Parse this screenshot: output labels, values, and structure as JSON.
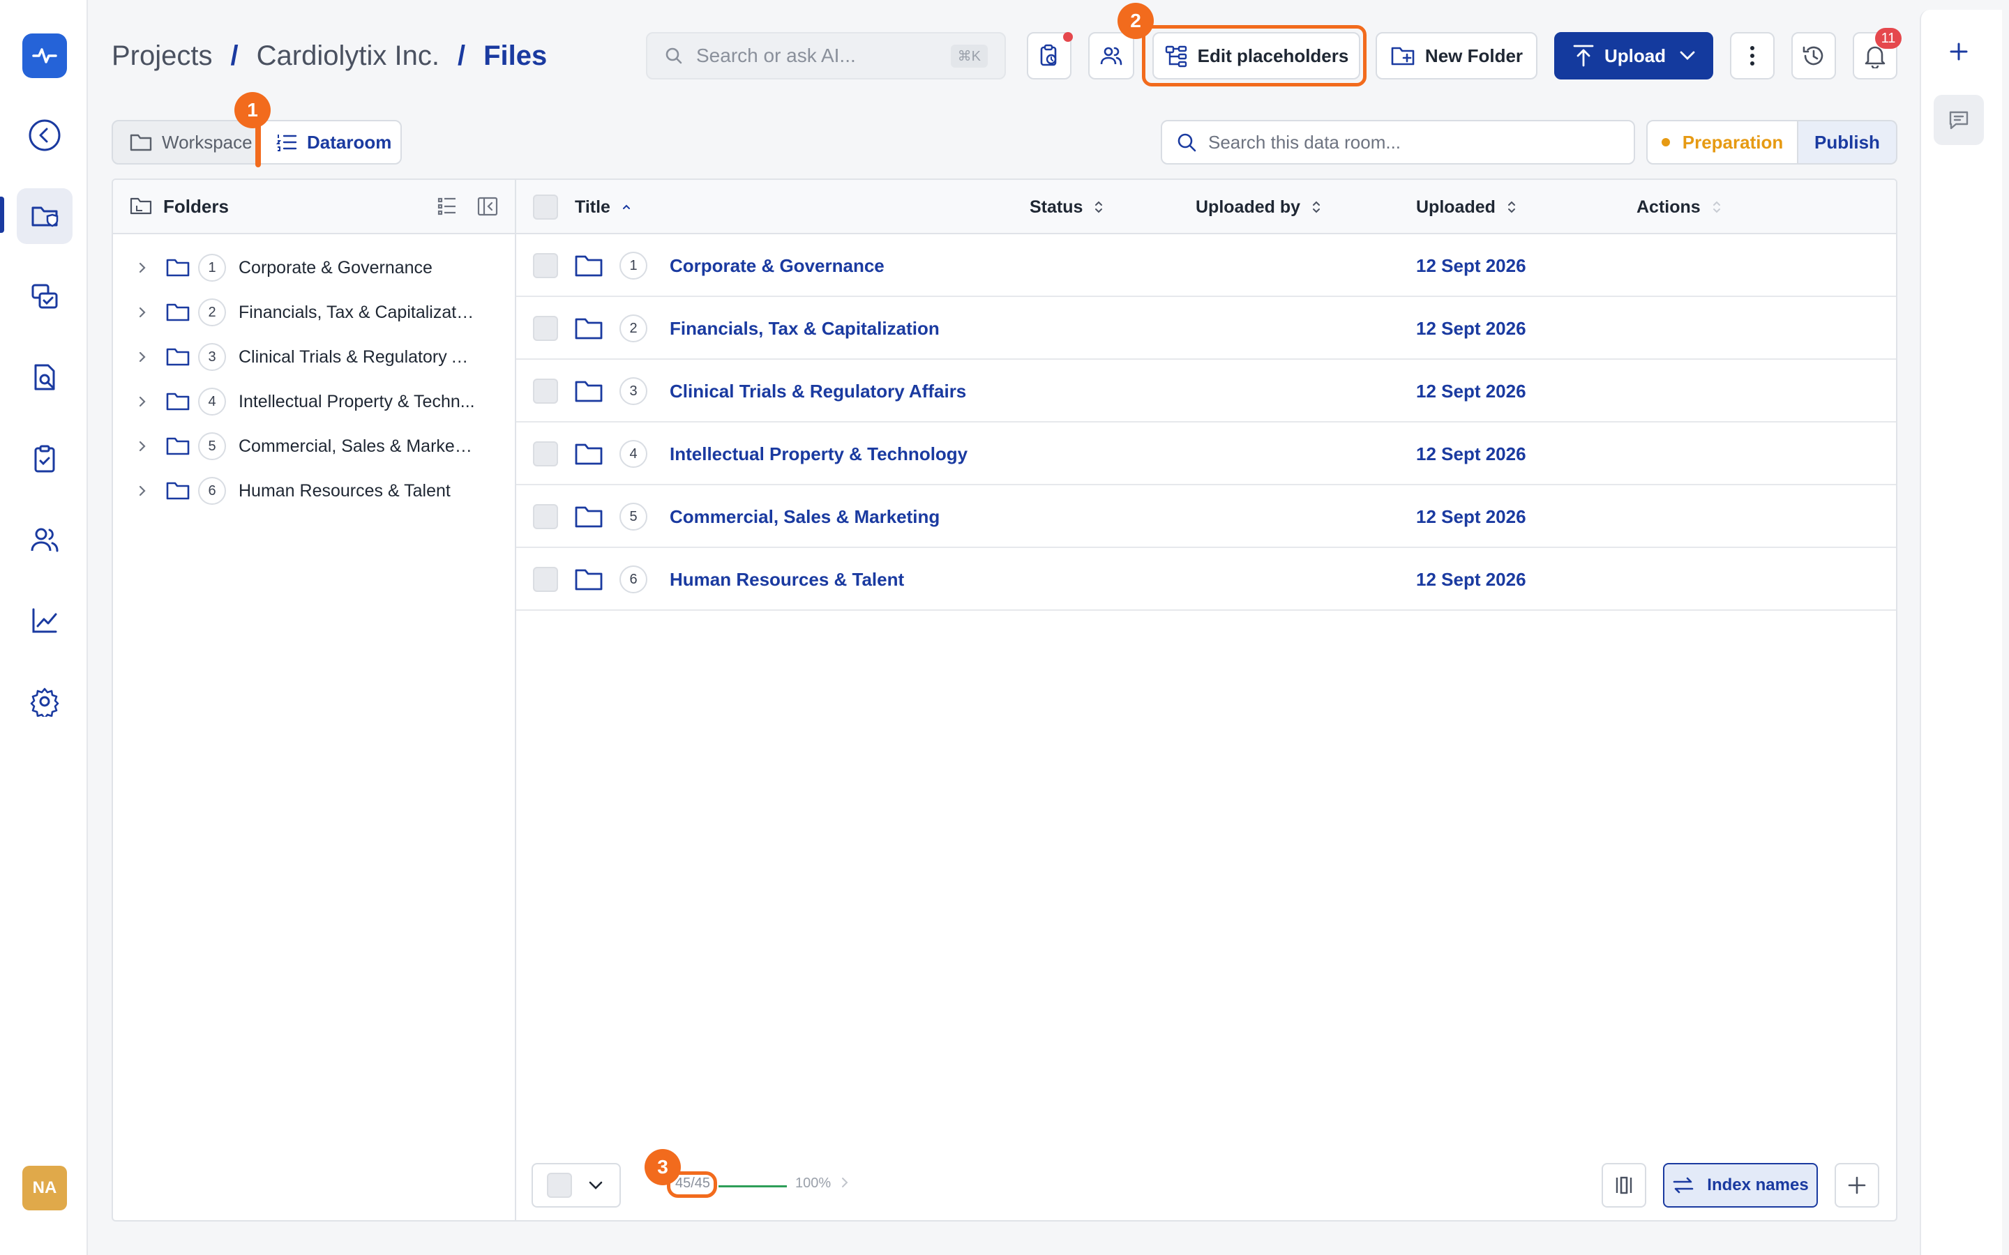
{
  "colors": {
    "brand": "#143a9e",
    "logo": "#2563d8",
    "highlight": "#f26b1d",
    "preparation": "#e69a13",
    "notification": "#e5484d",
    "progress": "#2e9e58"
  },
  "nav": {
    "logo_icon": "heartbeat-icon",
    "items": [
      "back-icon",
      "dataroom-files-icon",
      "qa-checklist-icon",
      "document-search-icon",
      "clipboard-icon",
      "users-icon",
      "analytics-icon",
      "settings-icon"
    ],
    "active": "dataroom-files-icon",
    "avatar": "NA"
  },
  "breadcrumb": {
    "items": [
      "Projects",
      "Cardiolytix Inc.",
      "Files"
    ],
    "separator": "/"
  },
  "search": {
    "placeholder": "Search or ask AI...",
    "shortcut": "⌘K"
  },
  "toolbar": {
    "edit_placeholders": "Edit placeholders",
    "new_folder": "New Folder",
    "upload": "Upload",
    "notifications_count": "11"
  },
  "steps": {
    "one": "1",
    "two": "2",
    "three": "3"
  },
  "view_tabs": {
    "workspace": "Workspace",
    "dataroom": "Dataroom",
    "active": "Dataroom"
  },
  "dataroom_search": {
    "placeholder": "Search this data room..."
  },
  "mode": {
    "preparation": "Preparation",
    "publish": "Publish",
    "active": "Publish"
  },
  "folders_panel": {
    "title": "Folders",
    "items": [
      {
        "num": "1",
        "label": "Corporate & Governance"
      },
      {
        "num": "2",
        "label": "Financials, Tax & Capitalization"
      },
      {
        "num": "3",
        "label": "Clinical Trials & Regulatory A..."
      },
      {
        "num": "4",
        "label": "Intellectual Property & Techn..."
      },
      {
        "num": "5",
        "label": "Commercial, Sales & Marketi..."
      },
      {
        "num": "6",
        "label": "Human Resources & Talent"
      }
    ]
  },
  "table": {
    "columns": {
      "title": "Title",
      "status": "Status",
      "uploaded_by": "Uploaded by",
      "uploaded": "Uploaded",
      "actions": "Actions"
    },
    "rows": [
      {
        "num": "1",
        "title": "Corporate & Governance",
        "status": "",
        "uploaded_by": "",
        "uploaded": "12 Sept 2026"
      },
      {
        "num": "2",
        "title": "Financials, Tax & Capitalization",
        "status": "",
        "uploaded_by": "",
        "uploaded": "12 Sept 2026"
      },
      {
        "num": "3",
        "title": "Clinical Trials & Regulatory Affairs",
        "status": "",
        "uploaded_by": "",
        "uploaded": "12 Sept 2026"
      },
      {
        "num": "4",
        "title": "Intellectual Property & Technology",
        "status": "",
        "uploaded_by": "",
        "uploaded": "12 Sept 2026"
      },
      {
        "num": "5",
        "title": "Commercial, Sales & Marketing",
        "status": "",
        "uploaded_by": "",
        "uploaded": "12 Sept 2026"
      },
      {
        "num": "6",
        "title": "Human Resources & Talent",
        "status": "",
        "uploaded_by": "",
        "uploaded": "12 Sept 2026"
      }
    ]
  },
  "footer": {
    "progress_count": "45/45",
    "progress_percent": "100%",
    "progress_fraction": 1.0,
    "index_names": "Index names"
  }
}
